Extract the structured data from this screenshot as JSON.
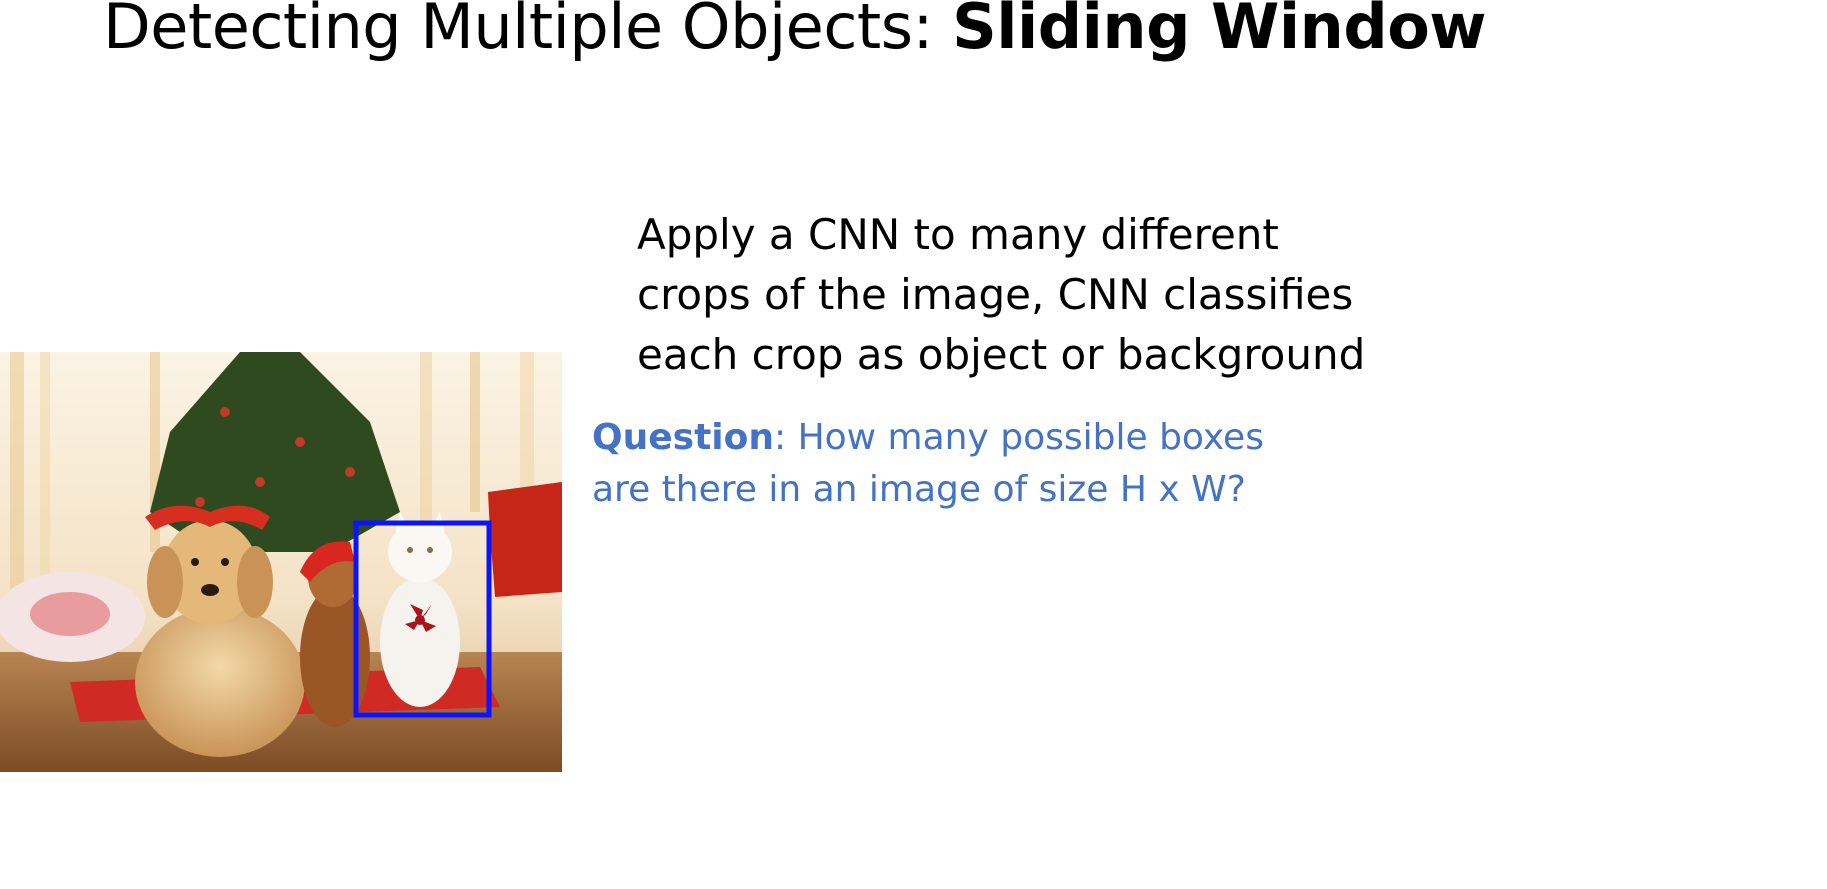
{
  "slide": {
    "title_regular": "Detecting Multiple Objects: ",
    "title_bold": "Sliding Window",
    "body_lines": [
      "Apply a CNN to many different",
      "crops of the image, CNN classifies",
      "each crop as object or background"
    ],
    "question_label": "Question",
    "question_line1_rest": ": How many possible boxes",
    "question_line2": "are there in an image of size H x W?"
  },
  "colors": {
    "question_text": "#4472c4",
    "box_outline": "#0a14ff"
  }
}
